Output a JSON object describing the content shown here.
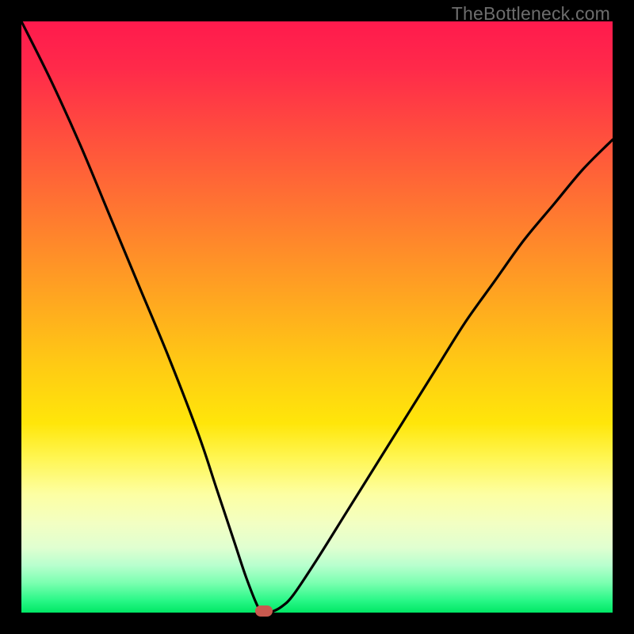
{
  "watermark": "TheBottleneck.com",
  "colors": {
    "frame": "#000000",
    "watermark": "#6d6d6d",
    "curve": "#000000",
    "marker": "#c9594f"
  },
  "chart_data": {
    "type": "line",
    "title": "",
    "xlabel": "",
    "ylabel": "",
    "xlim": [
      0,
      100
    ],
    "ylim": [
      0,
      100
    ],
    "grid": false,
    "legend": false,
    "series": [
      {
        "name": "bottleneck-curve",
        "x": [
          0,
          5,
          10,
          15,
          20,
          25,
          30,
          33,
          36,
          38,
          40,
          41,
          42,
          44,
          46,
          50,
          55,
          60,
          65,
          70,
          75,
          80,
          85,
          90,
          95,
          100
        ],
        "y": [
          100,
          90,
          79,
          67,
          55,
          43,
          30,
          21,
          12,
          6,
          1,
          0,
          0,
          1,
          3,
          9,
          17,
          25,
          33,
          41,
          49,
          56,
          63,
          69,
          75,
          80
        ]
      }
    ],
    "marker": {
      "x": 41,
      "y": 0
    },
    "background_gradient": {
      "top": "#ff1a4d",
      "mid": "#ffe60a",
      "bottom": "#00e765"
    }
  }
}
